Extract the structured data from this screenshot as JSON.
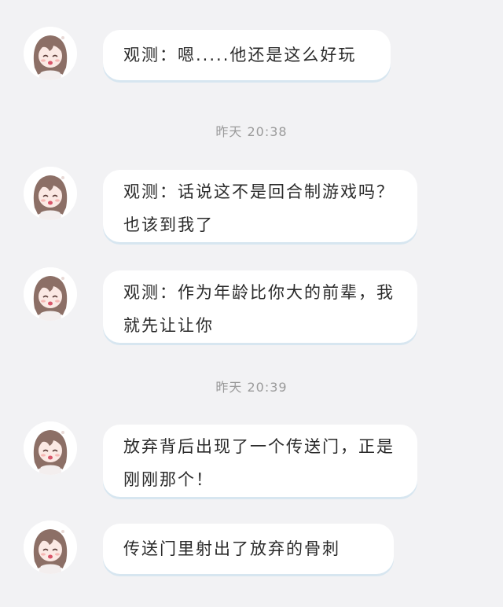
{
  "colors": {
    "background": "#f2f2f4",
    "bubble": "#ffffff",
    "bubble_shadow": "#d7e6f0",
    "timestamp_text": "#9a9a9a",
    "message_text": "#2a2a2a"
  },
  "messages": [
    {
      "avatar": "girl-avatar-icon",
      "text": "观测：嗯.....他还是这么好玩"
    },
    {
      "avatar": "girl-avatar-icon",
      "text": "观测：话说这不是回合制游戏吗？也该到我了"
    },
    {
      "avatar": "girl-avatar-icon",
      "text": "观测：作为年龄比你大的前辈，我就先让让你"
    },
    {
      "avatar": "girl-avatar-icon",
      "text": "放弃背后出现了一个传送门，正是刚刚那个！"
    },
    {
      "avatar": "girl-avatar-icon",
      "text": "传送门里射出了放弃的骨刺"
    }
  ],
  "timestamps": [
    {
      "text": "昨天 20:38"
    },
    {
      "text": "昨天 20:39"
    }
  ]
}
